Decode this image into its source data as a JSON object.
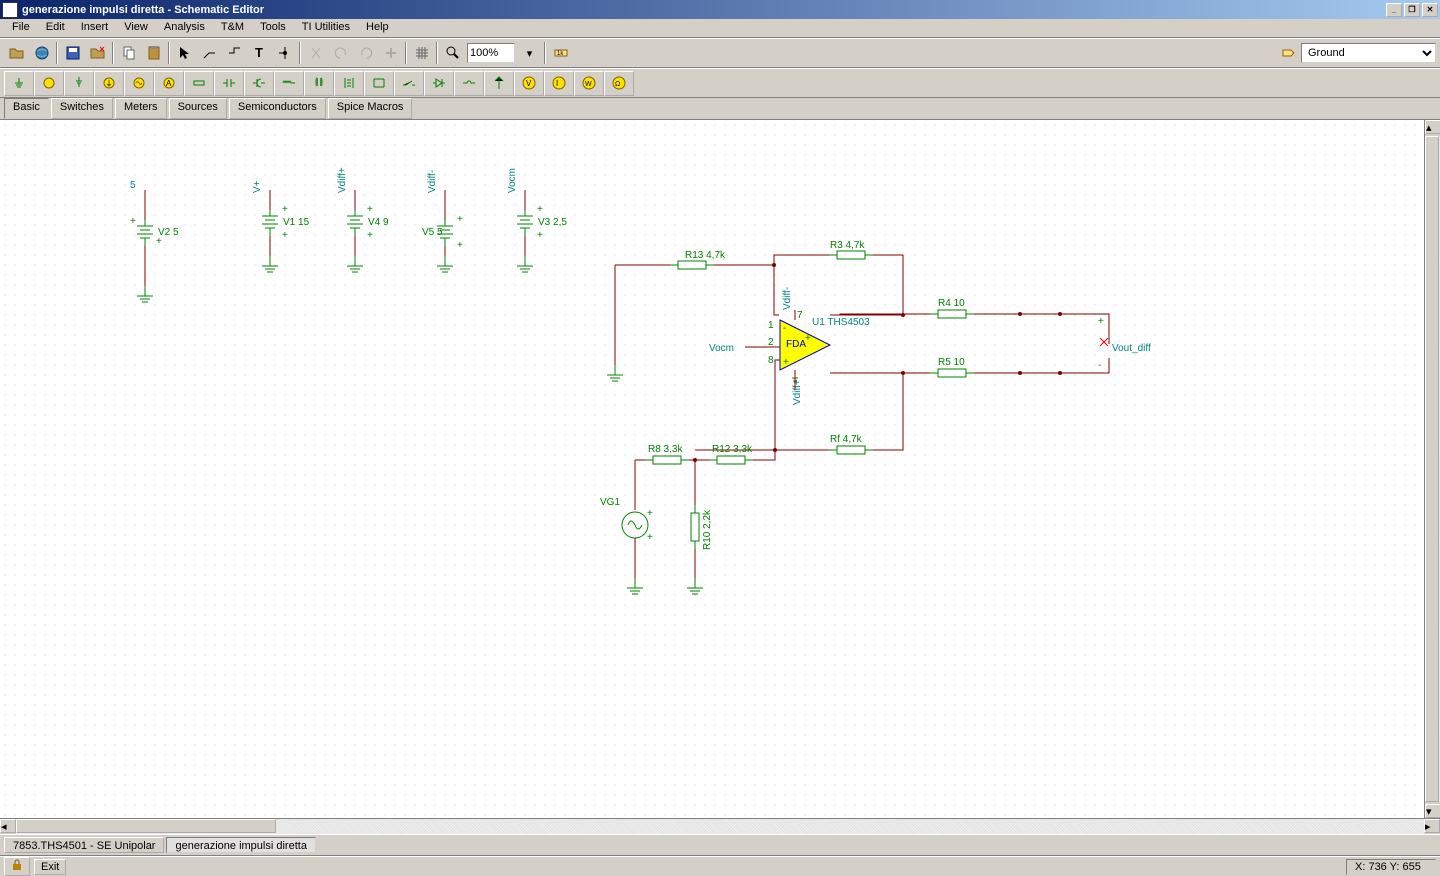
{
  "title": "generazione impulsi diretta - Schematic Editor",
  "menu": [
    "File",
    "Edit",
    "Insert",
    "View",
    "Analysis",
    "T&M",
    "Tools",
    "TI Utilities",
    "Help"
  ],
  "zoom": "100%",
  "net_label": "Ground",
  "component_tabs": [
    "Basic",
    "Switches",
    "Meters",
    "Sources",
    "Semiconductors",
    "Spice Macros"
  ],
  "bottom_tabs": [
    "7853.THS4501 - SE Unipolar",
    "generazione impulsi diretta"
  ],
  "status": {
    "exit": "Exit",
    "coords": "X: 736  Y: 655"
  },
  "schematic": {
    "sources": {
      "v2": {
        "net": "5",
        "label": "V2 5"
      },
      "v1": {
        "net": "V+",
        "label": "V1 15"
      },
      "v4": {
        "net": "Vdiff+",
        "label": "V4 9"
      },
      "v5": {
        "net": "Vdiff-",
        "label": "V5 5"
      },
      "v3": {
        "net": "Vocm",
        "label": "V3 2,5"
      },
      "vg1": {
        "label": "VG1"
      }
    },
    "resistors": {
      "r13": "R13 4,7k",
      "r3": "R3 4,7k",
      "r4": "R4 10",
      "r5": "R5 10",
      "r8": "R8 3,3k",
      "r12": "R12 3,3k",
      "rf": "Rf 4,7k",
      "r10": "R10 2,2k"
    },
    "amp": {
      "u1": "U1 THS4503",
      "inside": "FDA",
      "vocm_label": "Vocm",
      "vdiff_minus": "Vdiff-",
      "vdiff_plus": "Vdiff+",
      "pins": {
        "p1": "1",
        "p2": "2",
        "p7": "7",
        "p8": "8"
      }
    },
    "out": {
      "label": "Vout_diff"
    }
  }
}
